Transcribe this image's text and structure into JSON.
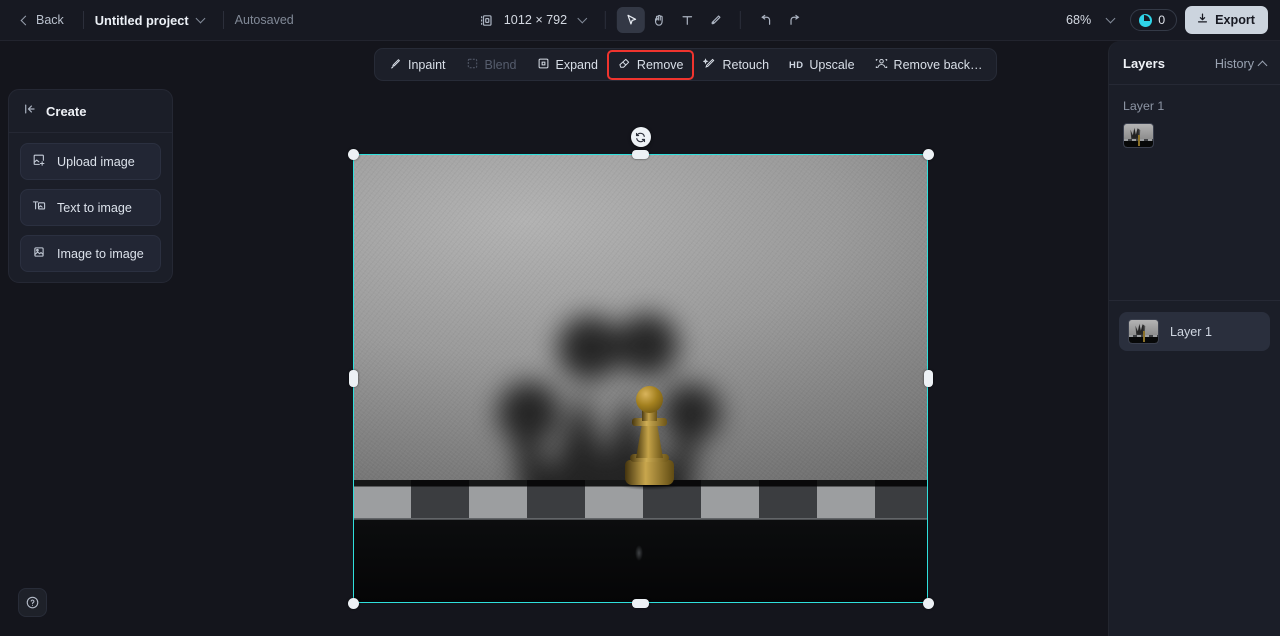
{
  "topbar": {
    "back_label": "Back",
    "project_name": "Untitled project",
    "autosaved_label": "Autosaved",
    "frame_icon": "frame-icon",
    "canvas_size": "1012 × 792",
    "tools": [
      {
        "name": "select-tool",
        "icon": "cursor-arrow-icon",
        "active": true
      },
      {
        "name": "hand-tool",
        "icon": "hand-icon",
        "active": false
      },
      {
        "name": "text-tool",
        "icon": "text-t-icon",
        "active": false
      },
      {
        "name": "brush-tool",
        "icon": "brush-icon",
        "active": false
      },
      {
        "name": "undo",
        "icon": "undo-arrow-icon",
        "active": false
      },
      {
        "name": "redo",
        "icon": "redo-arrow-icon",
        "active": false
      }
    ],
    "zoom_level": "68%",
    "credits_count": "0",
    "export_label": "Export",
    "export_icon": "download-icon"
  },
  "left_panel": {
    "collapse_icon": "collapse-left-icon",
    "title": "Create",
    "items": [
      {
        "label": "Upload image",
        "icon": "upload-image-icon"
      },
      {
        "label": "Text to image",
        "icon": "text-to-image-icon"
      },
      {
        "label": "Image to image",
        "icon": "image-to-image-icon"
      }
    ]
  },
  "canvas_toolbar": {
    "items": [
      {
        "label": "Inpaint",
        "icon": "inpaint-icon",
        "state": "normal"
      },
      {
        "label": "Blend",
        "icon": "blend-icon",
        "state": "disabled"
      },
      {
        "label": "Expand",
        "icon": "expand-icon",
        "state": "normal"
      },
      {
        "label": "Remove",
        "icon": "eraser-icon",
        "state": "highlighted"
      },
      {
        "label": "Retouch",
        "icon": "retouch-icon",
        "state": "normal"
      },
      {
        "label": "Upscale",
        "icon": "hd-icon",
        "state": "normal"
      },
      {
        "label": "Remove back…",
        "icon": "remove-background-icon",
        "state": "normal"
      }
    ],
    "highlight_color": "#f0342e"
  },
  "canvas": {
    "selection_color": "#2fe0dc",
    "rotate_icon": "rotate-icon",
    "image_description": "Blurred crown silhouette on a gray wall with a golden chess pawn on a checkered board"
  },
  "help": {
    "icon": "question-mark-icon"
  },
  "right_panel": {
    "layers_tab": "Layers",
    "history_tab": "History",
    "history_collapse_icon": "chevron-up-icon",
    "history_entry": "Layer 1",
    "layers": [
      {
        "name": "Layer 1"
      }
    ]
  }
}
